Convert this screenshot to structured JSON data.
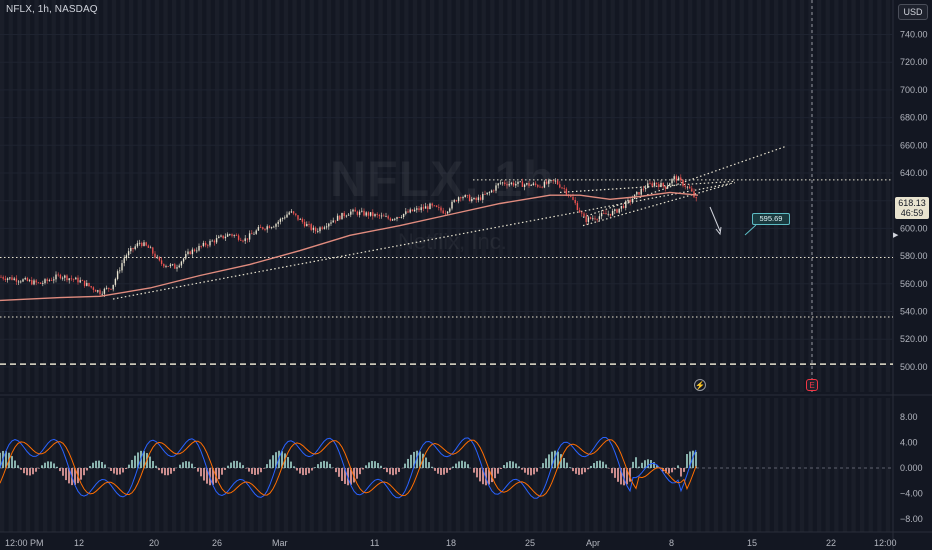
{
  "header": {
    "title": "NFLX, 1h, NASDAQ",
    "currency": "USD"
  },
  "watermark": {
    "symbol": "NFLX, 1h",
    "name": "Netflix, Inc."
  },
  "price_axis": {
    "labels": [
      "740.00",
      "720.00",
      "700.00",
      "680.00",
      "660.00",
      "640.00",
      "620.00",
      "600.00",
      "580.00",
      "560.00",
      "540.00",
      "520.00",
      "500.00"
    ],
    "current_price": "618.13",
    "countdown": "46:59"
  },
  "osc_axis": {
    "labels": [
      "8.00",
      "4.00",
      "0.000",
      "−4.00",
      "−8.00"
    ]
  },
  "time_axis": {
    "labels": [
      "12:00 PM",
      "12",
      "20",
      "26",
      "Mar",
      "11",
      "18",
      "25",
      "Apr",
      "8",
      "15",
      "22",
      "12:00"
    ]
  },
  "annotations": {
    "target_label": "595.69",
    "flash_icon": "lightning-icon",
    "earnings_icon": "E"
  },
  "colors": {
    "background": "#131722",
    "candle_up": "#e8e3cf",
    "candle_down": "#ef5350",
    "moving_average": "#e08b7e",
    "level_line": "#e8e3cf",
    "macd_line": "#2962ff",
    "signal_line": "#ff6d00",
    "hist_up": "#a6d8cf",
    "hist_down": "#f7a9a7"
  },
  "chart_data": {
    "type": "line",
    "title": "NFLX, 1h, NASDAQ",
    "xlabel": "",
    "ylabel": "",
    "ylim": [
      495,
      745
    ],
    "x": [
      "12:00 PM",
      "12",
      "20",
      "26",
      "Mar",
      "11",
      "18",
      "25",
      "Apr",
      "8",
      "15",
      "22"
    ],
    "series": [
      {
        "values": [
          565,
          558,
          590,
          598,
          605,
          614,
          618,
          636,
          608,
          636,
          615,
          null
        ]
      }
    ],
    "horizontal_levels": [
      635,
      579,
      536,
      502
    ],
    "target_price": 595.69,
    "oscillator": {
      "ylim": [
        -10,
        10
      ],
      "ticks": [
        8,
        4,
        0,
        -4,
        -8
      ]
    }
  }
}
